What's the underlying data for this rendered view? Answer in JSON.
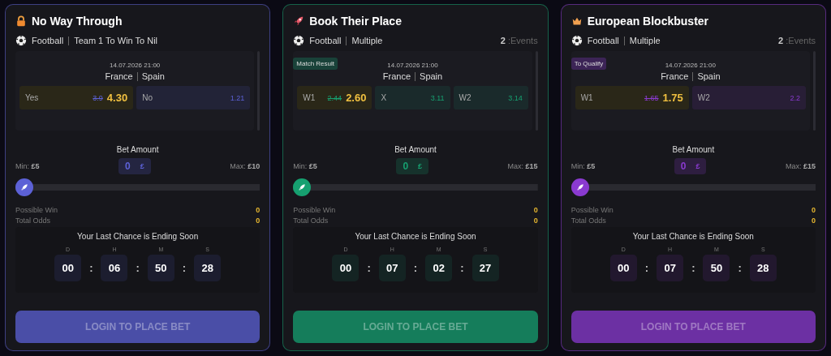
{
  "cards": [
    {
      "title": "No Way Through",
      "color": "#5c61d6",
      "sport": "Football",
      "market": "Team 1 To Win To Nil",
      "date": "14.07.2026 21:00",
      "home": "France",
      "away": "Spain",
      "odds": [
        {
          "label": "Yes",
          "old": "3.9",
          "value": "4.30",
          "selected": true
        },
        {
          "label": "No",
          "value": "1.21",
          "selected": false
        }
      ],
      "bet_label": "Bet Amount",
      "min_label": "Min:",
      "min": "£5",
      "amount": "0",
      "currency": "£",
      "max_label": "Max:",
      "max": "£10",
      "slider": {
        "level": 0
      },
      "possible_win_label": "Possible Win",
      "possible_win": "0",
      "total_odds_label": "Total Odds",
      "total_odds": "0",
      "countdown_title": "Your Last Chance is Ending Soon",
      "separator": ":",
      "countdown": [
        {
          "label": "D",
          "value": "00"
        },
        {
          "label": "H",
          "value": "06"
        },
        {
          "label": "M",
          "value": "50"
        },
        {
          "label": "S",
          "value": "28"
        }
      ],
      "button": "LOGIN TO PLACE BET"
    },
    {
      "title": "Book Their Place",
      "color": "#16a070",
      "sport": "Football",
      "market": "Multiple",
      "events_count": "2",
      "events_label": ":Events",
      "tag": "Match Result",
      "date": "14.07.2026 21:00",
      "home": "France",
      "away": "Spain",
      "odds": [
        {
          "label": "W1",
          "old": "2.44",
          "value": "2.60",
          "selected": true
        },
        {
          "label": "X",
          "value": "3.11",
          "selected": false
        },
        {
          "label": "W2",
          "value": "3.14",
          "selected": false
        }
      ],
      "bet_label": "Bet Amount",
      "min_label": "Min:",
      "min": "£5",
      "amount": "0",
      "currency": "£",
      "max_label": "Max:",
      "max": "£15",
      "slider": {
        "level": 0
      },
      "possible_win_label": "Possible Win",
      "possible_win": "0",
      "total_odds_label": "Total Odds",
      "total_odds": "0",
      "countdown_title": "Your Last Chance is Ending Soon",
      "separator": ":",
      "countdown": [
        {
          "label": "D",
          "value": "00"
        },
        {
          "label": "H",
          "value": "07"
        },
        {
          "label": "M",
          "value": "02"
        },
        {
          "label": "S",
          "value": "27"
        }
      ],
      "button": "LOGIN TO PLACE BET"
    },
    {
      "title": "European Blockbuster",
      "color": "#8a3ad0",
      "sport": "Football",
      "market": "Multiple",
      "events_count": "2",
      "events_label": ":Events",
      "tag": "To Qualify",
      "date": "14.07.2026 21:00",
      "home": "France",
      "away": "Spain",
      "odds": [
        {
          "label": "W1",
          "old": "1.65",
          "value": "1.75",
          "selected": true
        },
        {
          "label": "W2",
          "value": "2.2",
          "selected": false
        }
      ],
      "bet_label": "Bet Amount",
      "min_label": "Min:",
      "min": "£5",
      "amount": "0",
      "currency": "£",
      "max_label": "Max:",
      "max": "£15",
      "slider": {
        "level": 0
      },
      "possible_win_label": "Possible Win",
      "possible_win": "0",
      "total_odds_label": "Total Odds",
      "total_odds": "0",
      "countdown_title": "Your Last Chance is Ending Soon",
      "separator": ":",
      "countdown": [
        {
          "label": "D",
          "value": "00"
        },
        {
          "label": "H",
          "value": "07"
        },
        {
          "label": "M",
          "value": "50"
        },
        {
          "label": "S",
          "value": "28"
        }
      ],
      "button": "LOGIN TO PLACE BET"
    }
  ]
}
